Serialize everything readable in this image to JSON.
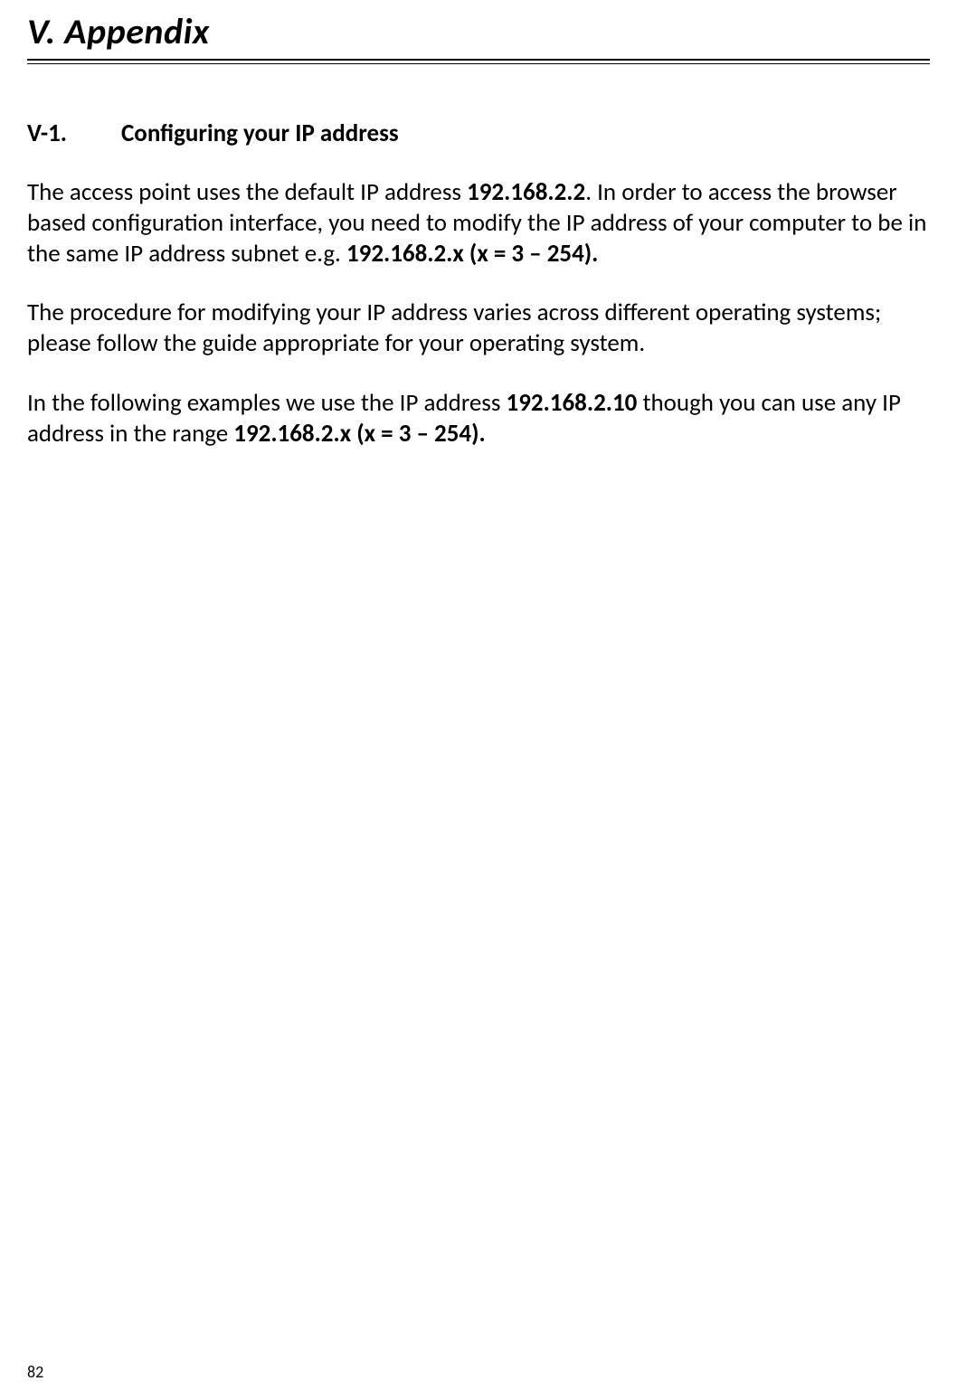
{
  "chapter": {
    "title": "V. Appendix"
  },
  "section": {
    "number": "V-1.",
    "title": "Configuring your IP address"
  },
  "para1": {
    "t1": "The access point uses the default IP address ",
    "b1": "192.168.2.2",
    "t2": ". In order to access the browser based configuration interface, you need to modify the IP address of your computer to be in the same IP address subnet e.g. ",
    "b2": "192.168.2.x (x = 3 – 254)."
  },
  "para2": {
    "t1": "The procedure for modifying your IP address varies across different operating systems; please follow the guide appropriate for your operating system."
  },
  "para3": {
    "t1": "In the following examples we use the IP address ",
    "b1": "192.168.2.10",
    "t2": " though you can use any IP address in the range ",
    "b2": "192.168.2.x (x = 3 – 254)."
  },
  "pageNumber": "82"
}
